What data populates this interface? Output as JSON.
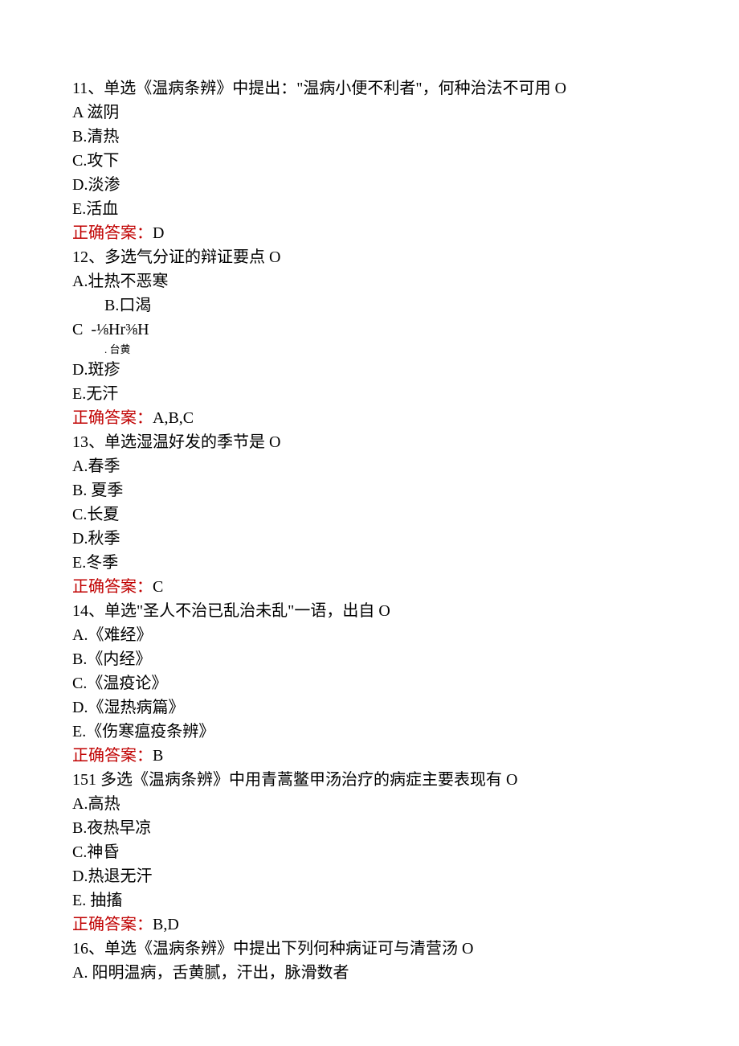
{
  "q11": {
    "stem": "11、单选《温病条辨》中提出：\"温病小便不利者\"，何种治法不可用 O",
    "A": "A 滋阴",
    "B": "B.清热",
    "C": "C.攻下",
    "D": "D.淡渗",
    "E": "E.活血",
    "ansLabel": "正确答案：",
    "ansValue": "D"
  },
  "q12": {
    "stem": "12、多选气分证的辩证要点 O",
    "A": "A.壮热不恶寒",
    "B": "B.口渴",
    "Cmain": "C  -⅛Hr⅜H",
    "Csub": ". 台黄",
    "D": "D.斑疹",
    "E": "E.无汗",
    "ansLabel": "正确答案：",
    "ansValue": "A,B,C"
  },
  "q13": {
    "stem": "13、单选湿温好发的季节是 O",
    "A": "A.春季",
    "B": "B. 夏季",
    "C": "C.长夏",
    "D": "D.秋季",
    "E": "E.冬季",
    "ansLabel": "正确答案：",
    "ansValue": "C"
  },
  "q14": {
    "stem": "14、单选\"圣人不治已乱治未乱\"一语，出自 O",
    "A": "A.《难经》",
    "B": "B.《内经》",
    "C": "C.《温疫论》",
    "D": "D.《湿热病篇》",
    "E": "E.《伤寒瘟疫条辨》",
    "ansLabel": "正确答案：",
    "ansValue": "B"
  },
  "q15": {
    "stem": "151 多选《温病条辨》中用青蒿鳖甲汤治疗的病症主要表现有 O",
    "A": "A.高热",
    "B": "B.夜热早凉",
    "C": "C.神昏",
    "D": "D.热退无汗",
    "E": "E. 抽搐",
    "ansLabel": "正确答案：",
    "ansValue": "B,D"
  },
  "q16": {
    "stem": "16、单选《温病条辨》中提出下列何种病证可与清营汤 O",
    "A": "A. 阳明温病，舌黄腻，汗出，脉滑数者"
  }
}
